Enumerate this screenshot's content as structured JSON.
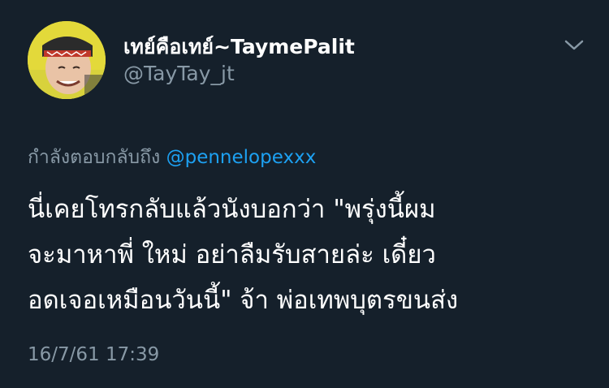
{
  "tweet": {
    "author": {
      "display_name": "เทย์คือเทย์~TaymePalit",
      "handle": "@TayTay_jt"
    },
    "reply_to": {
      "prefix": "กำลังตอบกลับถึง",
      "mention": "@pennelopexxx"
    },
    "text_lines": [
      "นี่เคยโทรกลับแล้วนังบอกว่า  \"พรุ่งนี้ผม",
      "จะมาหาพี่ ใหม่ อย่าลืมรับสายล่ะ เดี๋ยว",
      "อดเจอเหมือนวันนี้\" จ้า พ่อเทพบุตรขนส่ง"
    ],
    "timestamp": "16/7/61 17:39"
  },
  "icons": {
    "menu": "chevron-down-icon",
    "avatar": "avatar"
  },
  "colors": {
    "background": "#15202b",
    "primary_text": "#ffffff",
    "secondary_text": "#8899a6",
    "link": "#1da1f2"
  }
}
